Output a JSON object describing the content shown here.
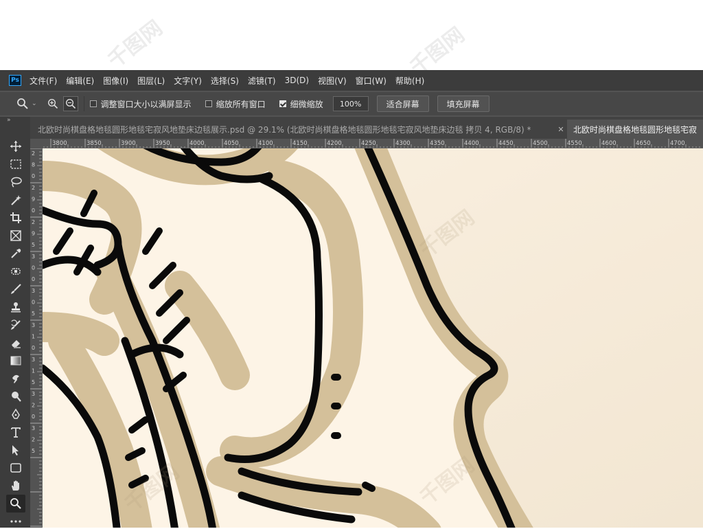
{
  "app": {
    "logo": "Ps"
  },
  "menu": [
    "文件(F)",
    "编辑(E)",
    "图像(I)",
    "图层(L)",
    "文字(Y)",
    "选择(S)",
    "滤镜(T)",
    "3D(D)",
    "视图(V)",
    "窗口(W)",
    "帮助(H)"
  ],
  "options": {
    "resize_windows_label": "调整窗口大小以满屏显示",
    "resize_windows_checked": false,
    "zoom_all_windows_label": "缩放所有窗口",
    "zoom_all_windows_checked": false,
    "scrubby_zoom_label": "细微缩放",
    "scrubby_zoom_checked": true,
    "zoom_value": "100%",
    "fit_screen_label": "适合屏幕",
    "fill_screen_label": "填充屏幕"
  },
  "tabs": [
    {
      "title": "北欧时尚棋盘格地毯圆形地毯宅寂风地垫床边毯展示.psd @ 29.1% (北欧时尚棋盘格地毯圆形地毯宅寂风地垫床边毯 拷贝 4, RGB/8) *",
      "active": false
    },
    {
      "title": "北欧时尚棋盘格地毯圆形地毯宅寂",
      "active": true
    }
  ],
  "ruler": {
    "top_ticks": [
      "50",
      "3800",
      "3850",
      "3900",
      "3950",
      "4000",
      "4050",
      "4100",
      "4150",
      "4200",
      "4250",
      "4300",
      "4350",
      "4400",
      "4450",
      "4500",
      "4550",
      "4600",
      "4650",
      "4700"
    ],
    "left_ticks": [
      "2",
      "8",
      "0",
      "2",
      "9",
      "0",
      "2",
      "9",
      "5",
      "3",
      "0",
      "0",
      "3",
      "0",
      "5",
      "3",
      "1",
      "0",
      "3",
      "1",
      "5",
      "3",
      "2",
      "0",
      "3",
      "2",
      "5"
    ]
  },
  "tools": [
    "move-tool",
    "marquee-tool",
    "lasso-tool",
    "magic-wand-tool",
    "crop-tool",
    "frame-tool",
    "eyedropper-tool",
    "healing-tool",
    "brush-tool",
    "stamp-tool",
    "history-brush-tool",
    "eraser-tool",
    "gradient-tool",
    "smudge-tool",
    "dodge-tool",
    "pen-tool",
    "type-tool",
    "path-selection-tool",
    "rectangle-tool",
    "hand-tool",
    "zoom-tool",
    "more-tools"
  ],
  "colors": {
    "menubar": "#3c3c3c",
    "panel": "#535353",
    "canvas_bg": "#f8eddc",
    "rug_border": "#d3bf98",
    "outline": "#0a0a0a"
  }
}
